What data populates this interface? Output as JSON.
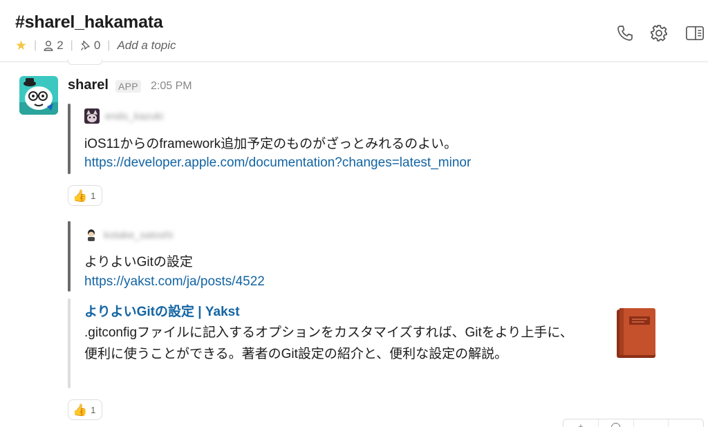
{
  "header": {
    "channel": "#sharel_hakamata",
    "members_count": "2",
    "pins_count": "0",
    "topic_placeholder": "Add a topic",
    "star_color": "#f2c744",
    "icons": [
      "star-icon",
      "member-icon",
      "pin-icon",
      "call-icon",
      "gear-icon",
      "sidebar-toggle-icon"
    ]
  },
  "message": {
    "sender": "sharel",
    "badge": "APP",
    "time": "2:05 PM",
    "attachments": [
      {
        "author": "endo_kazuki",
        "text": "iOS11からのframework追加予定のものがざっとみれるのよい。",
        "link": "https://developer.apple.com/documentation?changes=latest_minor",
        "reaction": {
          "emoji": "👍",
          "count": "1"
        }
      },
      {
        "author": "kotake_satoshi",
        "text": "よりよいGitの設定",
        "link": "https://yakst.com/ja/posts/4522",
        "preview": {
          "title": "よりよいGitの設定 | Yakst",
          "description": ".gitconfigファイルに記入するオプションをカスタマイズすれば、Gitをより上手に、便利に使うことができる。著者のGit設定の紹介と、便利な設定の解説。",
          "thumbnail": "book-icon"
        },
        "reaction": {
          "emoji": "👍",
          "count": "1"
        }
      }
    ]
  },
  "colors": {
    "link": "#1264a3",
    "quote_bar": "#6b6b6b",
    "preview_bar": "#dddddd",
    "thumbnail": "#b84a2a"
  }
}
